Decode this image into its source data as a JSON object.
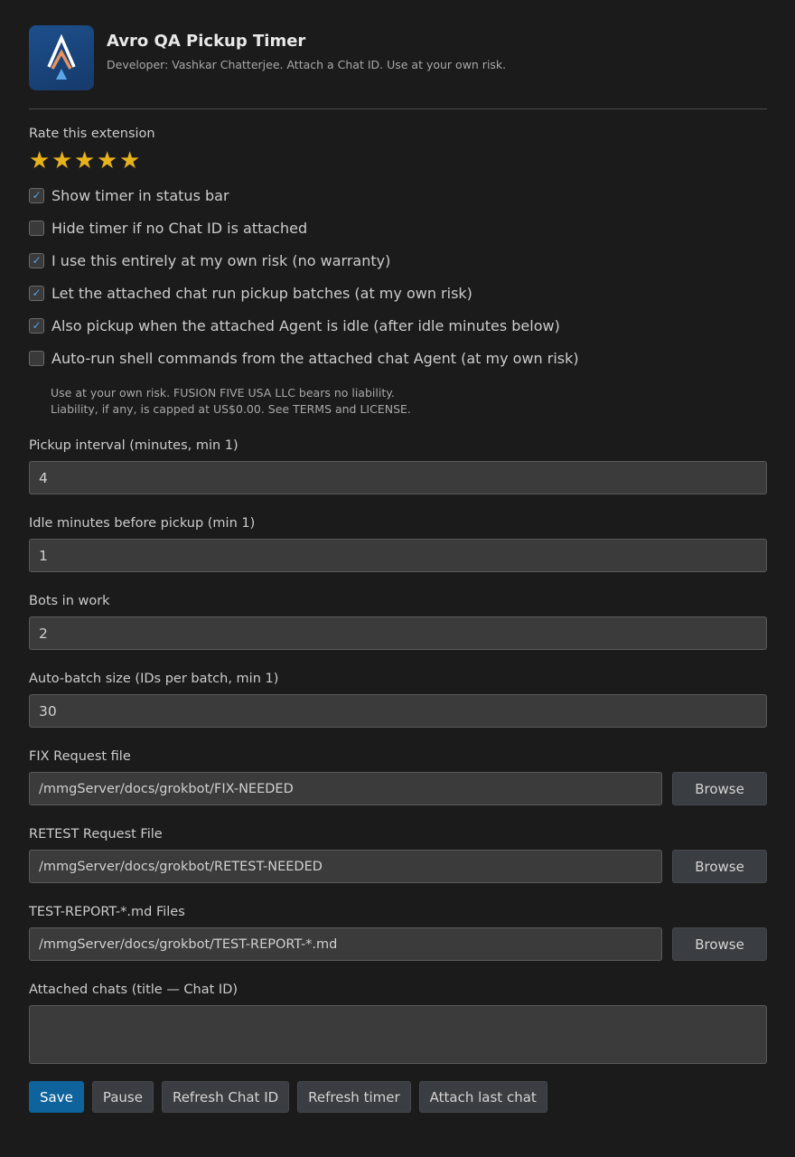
{
  "header": {
    "title": "Avro QA Pickup Timer",
    "subtitle": "Developer: Vashkar Chatterjee. Attach a Chat ID. Use at your own risk.",
    "logo_icon": "avro-logo-icon"
  },
  "rating": {
    "label": "Rate this extension",
    "stars": [
      "★",
      "★",
      "★",
      "★",
      "★"
    ],
    "star_color": "#e8b21b"
  },
  "options": [
    {
      "label": "Show timer in status bar",
      "checked": true
    },
    {
      "label": "Hide timer if no Chat ID is attached",
      "checked": false
    },
    {
      "label": "I use this entirely at my own risk (no warranty)",
      "checked": true
    },
    {
      "label": "Let the attached chat run pickup batches (at my own risk)",
      "checked": true
    },
    {
      "label": "Also pickup when the attached Agent is idle (after idle minutes below)",
      "checked": true
    },
    {
      "label": "Auto-run shell commands from the attached chat Agent (at my own risk)",
      "checked": false
    }
  ],
  "disclaimer": {
    "line1": "Use at your own risk. FUSION FIVE USA LLC bears no liability.",
    "line2": "Liability, if any, is capped at US$0.00. See TERMS and LICENSE."
  },
  "fields": {
    "pickup_interval": {
      "label": "Pickup interval (minutes, min 1)",
      "value": "4"
    },
    "idle_minutes": {
      "label": "Idle minutes before pickup (min 1)",
      "value": "1"
    },
    "bots_in_work": {
      "label": "Bots in work",
      "value": "2"
    },
    "batch_size": {
      "label": "Auto-batch size (IDs per batch, min 1)",
      "value": "30"
    }
  },
  "files": {
    "fix": {
      "label": "FIX Request file",
      "value": "/mmgServer/docs/grokbot/FIX-NEEDED",
      "button": "Browse"
    },
    "retest": {
      "label": "RETEST Request File",
      "value": "/mmgServer/docs/grokbot/RETEST-NEEDED",
      "button": "Browse"
    },
    "report": {
      "label": "TEST-REPORT-*.md Files",
      "value": "/mmgServer/docs/grokbot/TEST-REPORT-*.md",
      "button": "Browse"
    }
  },
  "attached": {
    "label": "Attached chats (title — Chat ID)",
    "value": ""
  },
  "actions": {
    "save": "Save",
    "pause": "Pause",
    "refresh_chat": "Refresh Chat ID",
    "refresh_timer": "Refresh timer",
    "attach_last": "Attach last chat"
  },
  "colors": {
    "background": "#1b1b1b",
    "primary_button": "#0e639c",
    "checkbox_tick": "#4fa3e8"
  }
}
